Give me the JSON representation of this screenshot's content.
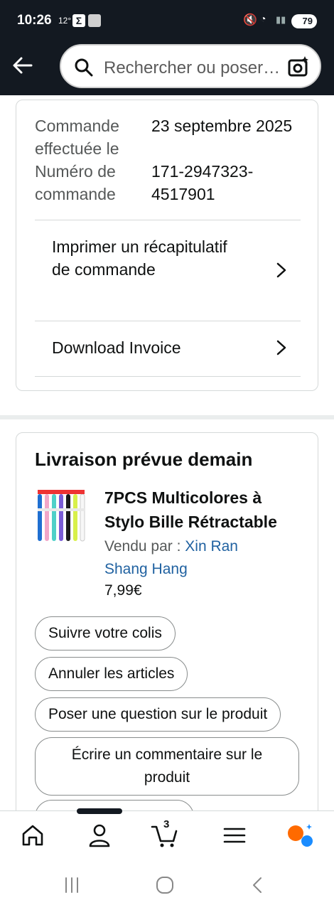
{
  "status_bar": {
    "time": "10:26",
    "temperature": "12°",
    "battery": "79"
  },
  "search": {
    "placeholder": "Rechercher ou poser une question"
  },
  "order": {
    "date_label": "Commande effectuée le",
    "date_value": "23 septembre 2025",
    "number_label": "Numéro de commande",
    "number_value": "171-2947323-4517901",
    "links": [
      {
        "label": "Imprimer un récapitulatif de commande"
      },
      {
        "label": "Download Invoice"
      }
    ]
  },
  "shipment": {
    "title": "Livraison prévue demain",
    "product": {
      "name_line1": "7PCS Multicolores à",
      "name_line2": "Stylo Bille Rétractable",
      "sold_by_label": "Vendu par  : ",
      "seller_line1": "Xin Ran",
      "seller_line2": "Shang Hang",
      "price": "7,99€"
    },
    "actions": [
      "Suivre votre colis",
      "Annuler les articles",
      "Poser une question sur le produit",
      "Écrire un commentaire sur le produit"
    ]
  },
  "bottom_nav": {
    "cart_count": "3",
    "items": [
      "home-icon",
      "account-icon",
      "cart-icon",
      "menu-icon",
      "rufus-icon"
    ]
  },
  "colors": {
    "header_bg": "#131921",
    "link_blue": "#2162a1",
    "accent_orange": "#ff6a00",
    "accent_blue": "#1a8cff"
  }
}
